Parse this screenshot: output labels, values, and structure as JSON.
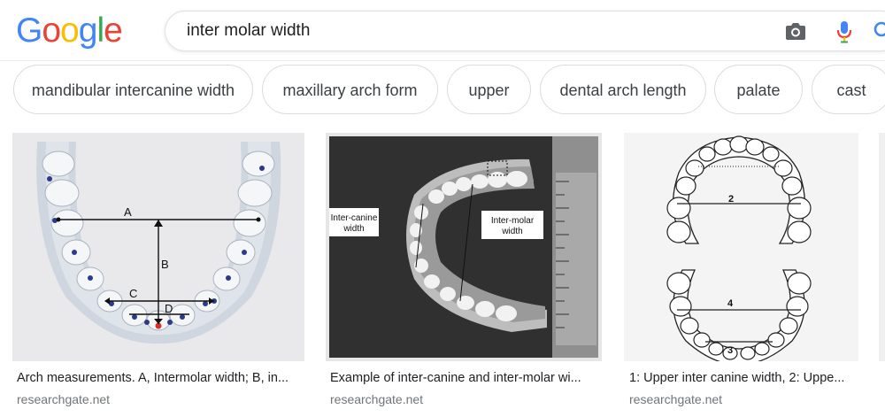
{
  "logo": {
    "letters": [
      "G",
      "o",
      "o",
      "g",
      "l",
      "e"
    ],
    "colors": [
      "#4285F4",
      "#EA4335",
      "#FBBC05",
      "#4285F4",
      "#34A853",
      "#EA4335"
    ]
  },
  "search": {
    "query": "inter molar width"
  },
  "chips": [
    "mandibular intercanine width",
    "maxillary arch form",
    "upper",
    "dental arch length",
    "palate",
    "cast"
  ],
  "results": [
    {
      "caption": "Arch measurements. A, Intermolar width; B, in...",
      "source": "researchgate.net",
      "labels": {
        "a": "A",
        "b": "B",
        "c": "C",
        "d": "D"
      }
    },
    {
      "caption": "Example of inter-canine and inter-molar wi...",
      "source": "researchgate.net",
      "labels": {
        "canine1": "Inter-canine",
        "canine2": "width",
        "molar1": "Inter-molar",
        "molar2": "width"
      }
    },
    {
      "caption": "1: Upper inter canine width, 2: Uppe...",
      "source": "researchgate.net",
      "labels": {
        "n2": "2",
        "n4": "4",
        "n3": "3"
      }
    }
  ],
  "colors": {
    "accent": "#4285F4",
    "chip_border": "#dadce0",
    "source": "#70757a"
  }
}
